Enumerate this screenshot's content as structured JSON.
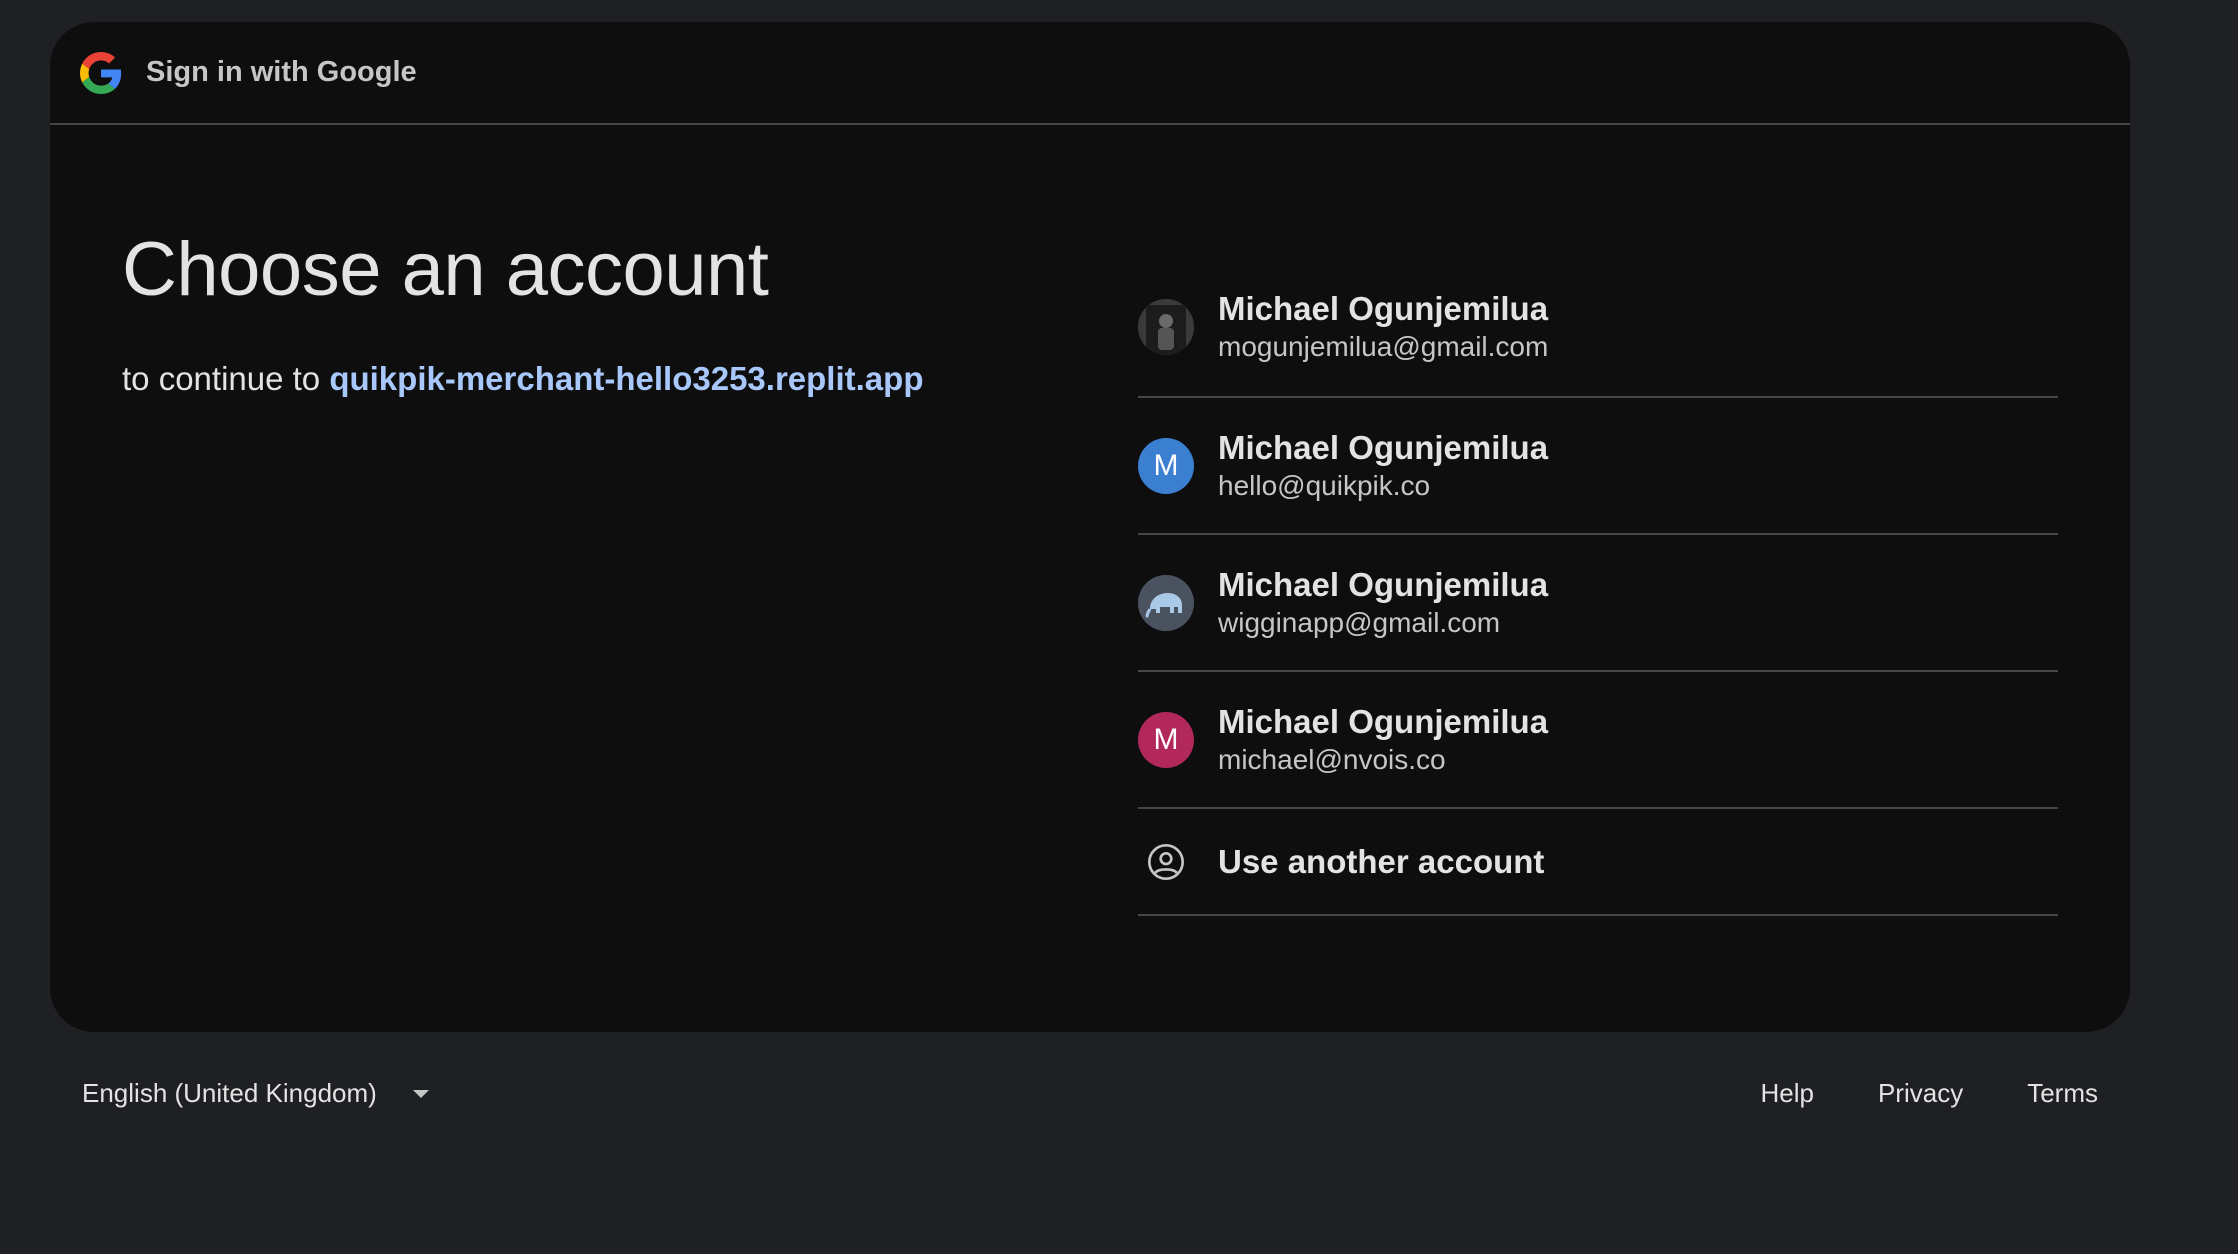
{
  "header": {
    "title": "Sign in with Google",
    "logo_icon": "google-g-icon"
  },
  "main": {
    "title": "Choose an account",
    "continue_prefix": "to continue to",
    "continue_app": "quikpik-merchant-hello3253.replit.app"
  },
  "accounts": [
    {
      "name": "Michael Ogunjemilua",
      "email": "mogunjemilua@gmail.com",
      "avatar": "photo",
      "avatar_icon": "photo-avatar-icon"
    },
    {
      "name": "Michael Ogunjemilua",
      "email": "hello@quikpik.co",
      "avatar": "M",
      "avatar_color": "#3a7fd0"
    },
    {
      "name": "Michael Ogunjemilua",
      "email": "wigginapp@gmail.com",
      "avatar": "elephant",
      "avatar_icon": "elephant-avatar-icon"
    },
    {
      "name": "Michael Ogunjemilua",
      "email": "michael@nvois.co",
      "avatar": "M",
      "avatar_color": "#b3285a"
    }
  ],
  "use_another": {
    "label": "Use another account",
    "icon": "account-circle-icon"
  },
  "footer": {
    "language": "English (United Kingdom)",
    "links": [
      "Help",
      "Privacy",
      "Terms"
    ]
  },
  "colors": {
    "page_bg": "#1f2023",
    "card_bg": "#0e0e0f",
    "link": "#a8c7fa",
    "divider": "#444746"
  }
}
